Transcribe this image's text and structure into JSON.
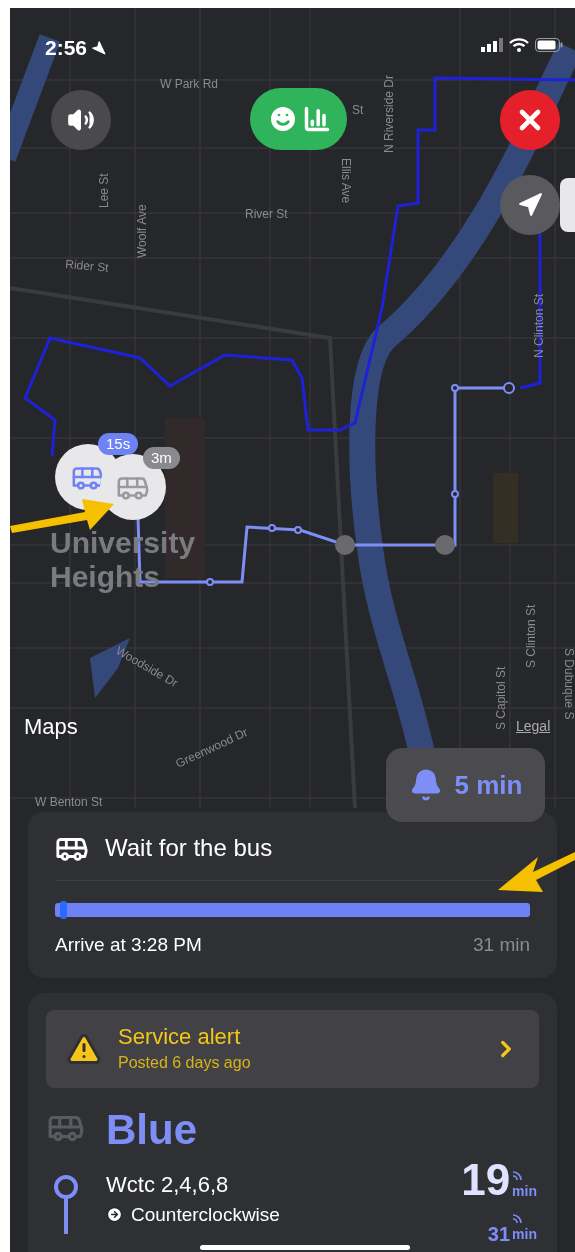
{
  "status_bar": {
    "time": "2:56"
  },
  "map": {
    "labels": [
      "W Park Rd",
      "St",
      "Lee St",
      "Ellis Ave",
      "N Riverside Dr",
      "River St",
      "Rider St",
      "Woolf Ave",
      "N Clinton St",
      "Woodside Dr",
      "Greenwood Dr",
      "S Capitol St",
      "S Clinton St",
      "S Dubuque S",
      "W Benton St"
    ],
    "area_label": "University Heights",
    "attribution": "Maps",
    "legal": "Legal",
    "vehicles": [
      {
        "badge": "15s",
        "kind": "live"
      },
      {
        "badge": "3m",
        "kind": "stale"
      }
    ]
  },
  "alarm_button": {
    "label": "5 min"
  },
  "wait_card": {
    "title": "Wait for the bus",
    "level": 0.01,
    "arrive": "Arrive at 3:28 PM",
    "duration": "31 min"
  },
  "route_card": {
    "alert": {
      "title": "Service alert",
      "subtitle": "Posted 6 days ago"
    },
    "route": "Blue",
    "stop": "Wctc 2,4,6,8",
    "direction": "Counterclockwise",
    "departures": [
      {
        "time": "19",
        "unit": "min"
      },
      {
        "time": "31",
        "unit": "min"
      }
    ]
  }
}
